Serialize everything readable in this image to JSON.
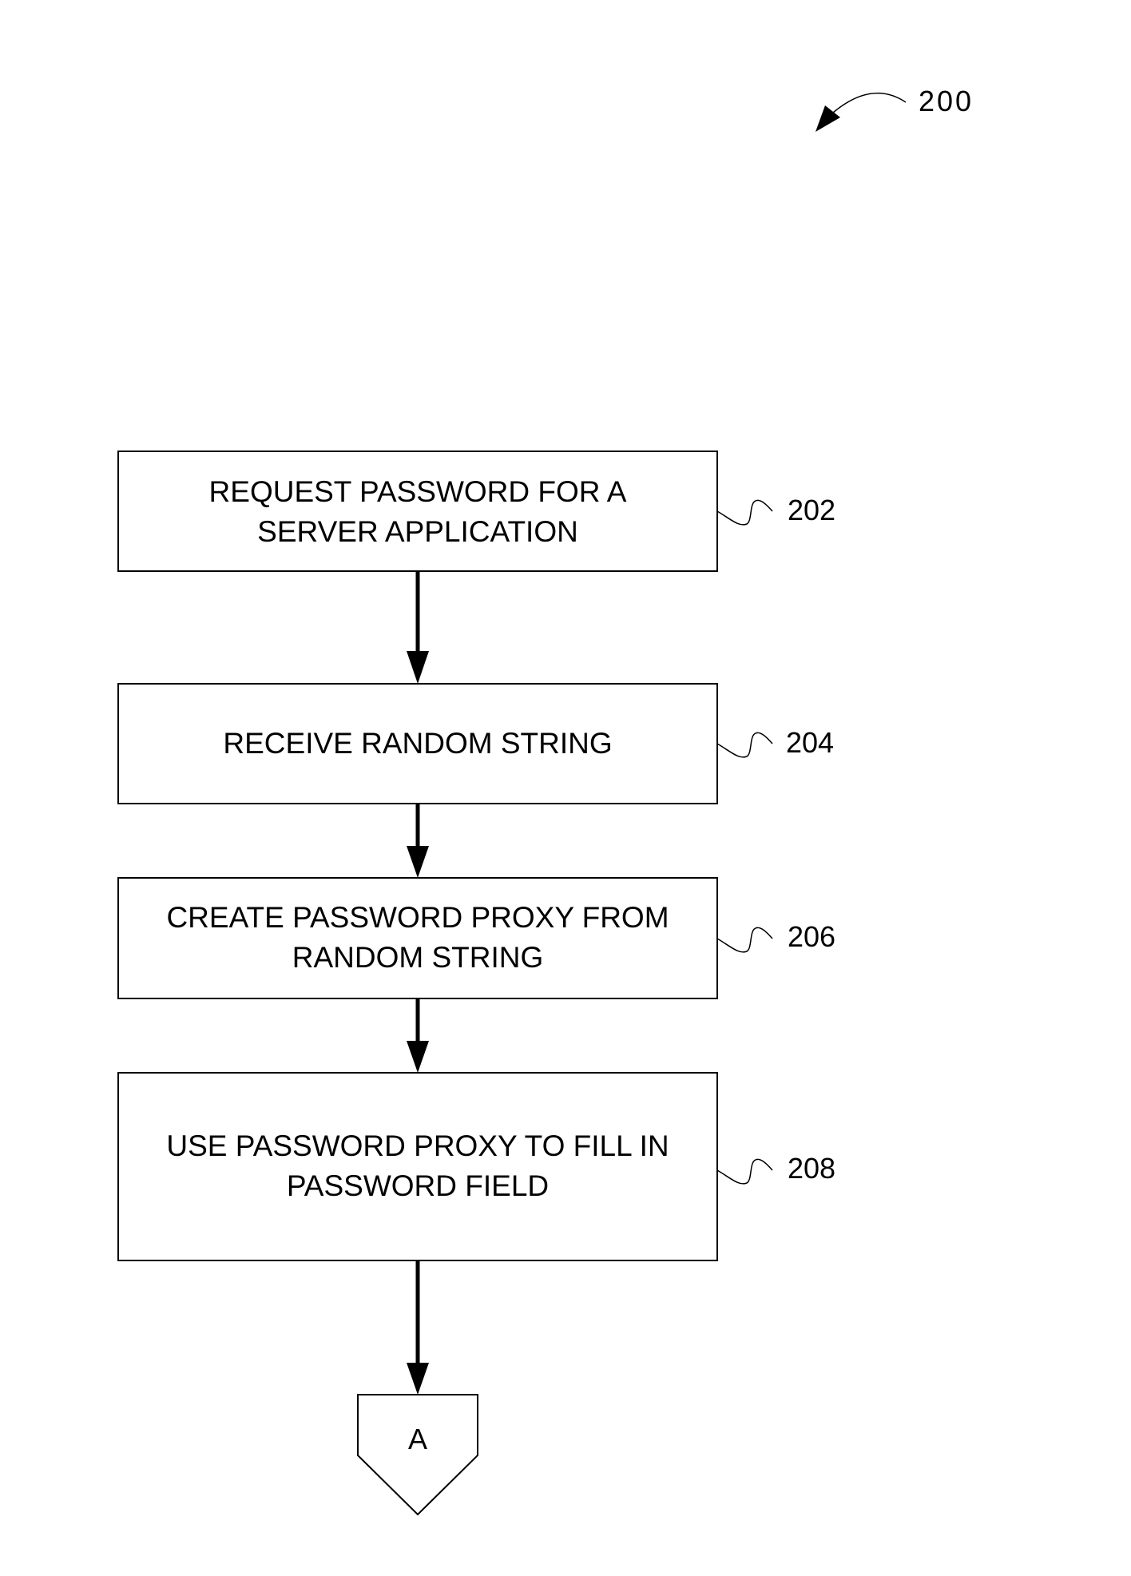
{
  "figure": {
    "label": "200"
  },
  "steps": [
    {
      "ref": "202",
      "lines": [
        "REQUEST PASSWORD FOR A",
        "SERVER APPLICATION"
      ]
    },
    {
      "ref": "204",
      "lines": [
        "RECEIVE RANDOM STRING"
      ]
    },
    {
      "ref": "206",
      "lines": [
        "CREATE PASSWORD PROXY FROM",
        "RANDOM STRING"
      ]
    },
    {
      "ref": "208",
      "lines": [
        "USE PASSWORD PROXY TO FILL IN",
        "PASSWORD FIELD"
      ]
    }
  ],
  "connector": {
    "label": "A"
  },
  "colors": {
    "stroke": "#000000",
    "background": "#ffffff"
  }
}
